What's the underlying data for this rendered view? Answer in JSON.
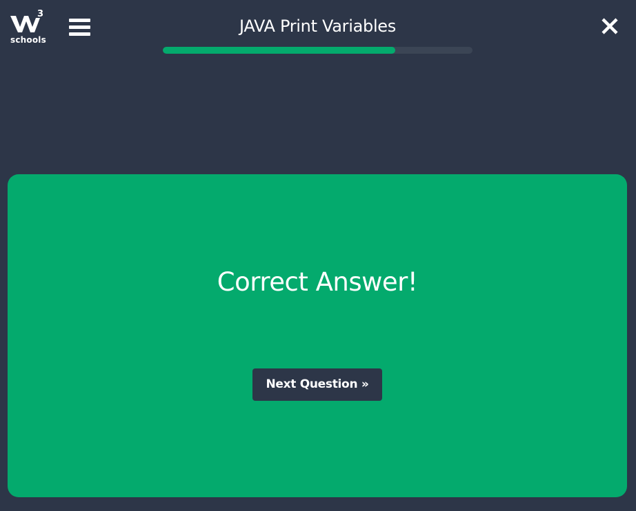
{
  "header": {
    "logo": {
      "mark": "W",
      "superscript": "3",
      "text": "schools",
      "icon": "w3schools-logo-icon"
    },
    "menu_icon": "hamburger-menu-icon",
    "title": "JAVA Print Variables",
    "progress": {
      "fraction": 0.75
    },
    "close_icon": "close-icon"
  },
  "result": {
    "message": "Correct Answer!",
    "next_label": "Next Question »"
  },
  "colors": {
    "background": "#2d3648",
    "accent": "#04aa6d",
    "progress_track": "#3b4555",
    "text": "#ffffff"
  }
}
